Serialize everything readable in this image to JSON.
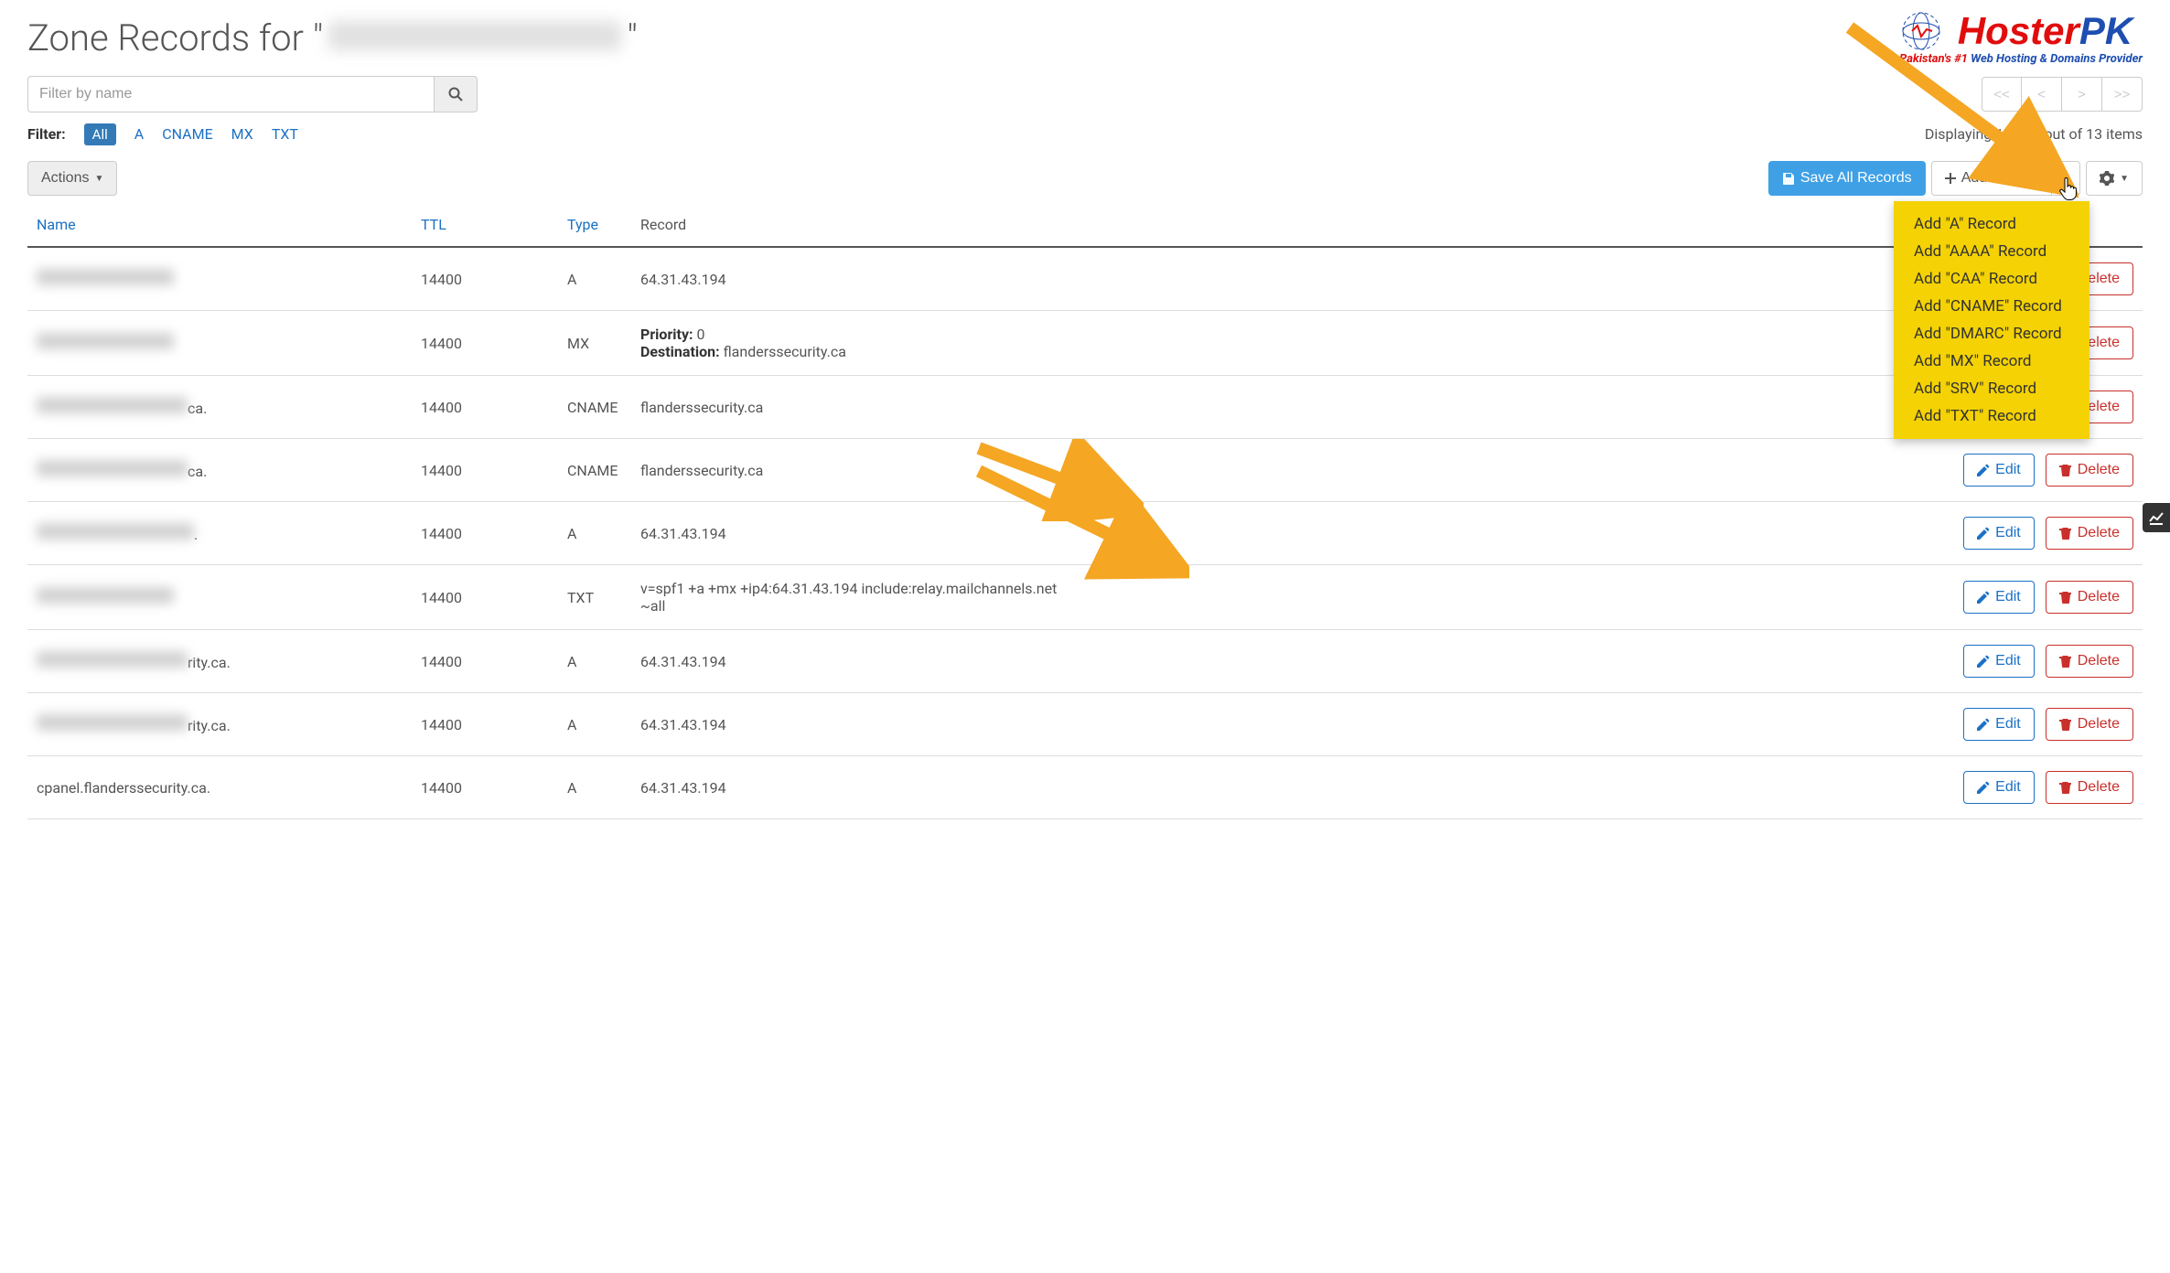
{
  "logo": {
    "brand_red": "Hoster",
    "brand_blue": "PK",
    "tag_red": "Pakistan's #1",
    "tag_blue": "Web Hosting & Domains Provider"
  },
  "title": {
    "prefix": "Zone Records for \"",
    "suffix": "\""
  },
  "filter": {
    "placeholder": "Filter by name",
    "label": "Filter:",
    "items": [
      "All",
      "A",
      "CNAME",
      "MX",
      "TXT"
    ],
    "active": "All"
  },
  "pager": {
    "first": "<<",
    "prev": "<",
    "next": ">",
    "last": ">>"
  },
  "displaying": "Displaying 1 to 13 out of 13 items",
  "toolbar": {
    "actions": "Actions",
    "save_all": "Save All Records",
    "add_record": "Add Record"
  },
  "table": {
    "headers": {
      "name": "Name",
      "ttl": "TTL",
      "type": "Type",
      "record": "Record"
    },
    "edit": "Edit",
    "delete": "Delete",
    "rows": [
      {
        "name_blur": 150,
        "name_suffix": "",
        "ttl": "14400",
        "type": "A",
        "record_lines": [
          "64.31.43.194"
        ]
      },
      {
        "name_blur": 150,
        "name_suffix": "",
        "ttl": "14400",
        "type": "MX",
        "record_kv": [
          [
            "Priority:",
            "0"
          ],
          [
            "Destination:",
            "flanderssecurity.ca"
          ]
        ]
      },
      {
        "name_blur": 165,
        "name_suffix": "ca.",
        "ttl": "14400",
        "type": "CNAME",
        "record_lines": [
          "flanderssecurity.ca"
        ]
      },
      {
        "name_blur": 165,
        "name_suffix": "ca.",
        "ttl": "14400",
        "type": "CNAME",
        "record_lines": [
          "flanderssecurity.ca"
        ]
      },
      {
        "name_blur": 172,
        "name_suffix": ".",
        "ttl": "14400",
        "type": "A",
        "record_lines": [
          "64.31.43.194"
        ]
      },
      {
        "name_blur": 150,
        "name_suffix": "",
        "ttl": "14400",
        "type": "TXT",
        "record_lines": [
          "v=spf1 +a +mx +ip4:64.31.43.194 include:relay.mailchannels.net ~all"
        ]
      },
      {
        "name_blur": 165,
        "name_suffix": "rity.ca.",
        "ttl": "14400",
        "type": "A",
        "record_lines": [
          "64.31.43.194"
        ]
      },
      {
        "name_blur": 165,
        "name_suffix": "rity.ca.",
        "ttl": "14400",
        "type": "A",
        "record_lines": [
          "64.31.43.194"
        ]
      },
      {
        "name_blur": 0,
        "name_full": "cpanel.flanderssecurity.ca.",
        "ttl": "14400",
        "type": "A",
        "record_lines": [
          "64.31.43.194"
        ]
      }
    ]
  },
  "dropdown": {
    "items": [
      "Add \"A\" Record",
      "Add \"AAAA\" Record",
      "Add \"CAA\" Record",
      "Add \"CNAME\" Record",
      "Add \"DMARC\" Record",
      "Add \"MX\" Record",
      "Add \"SRV\" Record",
      "Add \"TXT\" Record"
    ]
  }
}
